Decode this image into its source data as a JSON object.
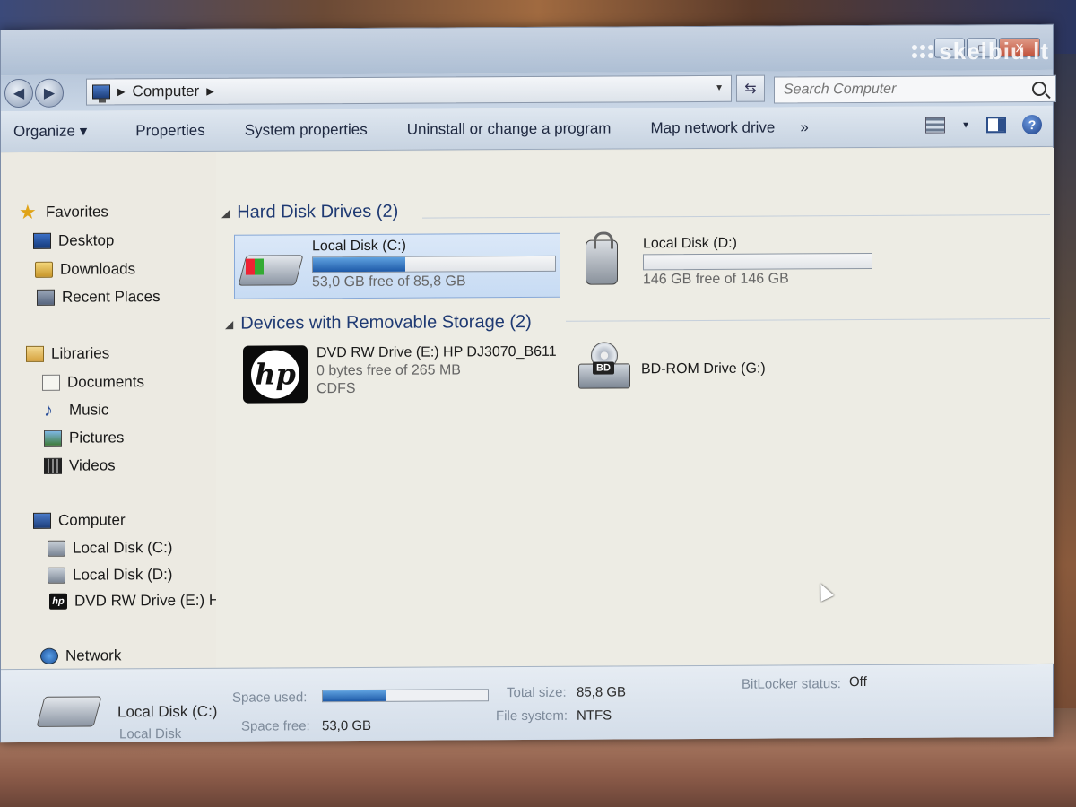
{
  "watermark": "skelbiu.lt",
  "window": {
    "controls": [
      "–",
      "□",
      "X"
    ]
  },
  "address": {
    "location": "Computer",
    "separator": "▸",
    "search_placeholder": "Search Computer"
  },
  "toolbar": {
    "items": [
      "Organize ▾",
      "Properties",
      "System properties",
      "Uninstall or change a program",
      "Map network drive",
      "»"
    ]
  },
  "nav": {
    "favorites": "Favorites",
    "desktop": "Desktop",
    "downloads": "Downloads",
    "recent": "Recent Places",
    "libraries": "Libraries",
    "documents": "Documents",
    "music": "Music",
    "pictures": "Pictures",
    "videos": "Videos",
    "computer": "Computer",
    "drive_c": "Local Disk (C:)",
    "drive_d": "Local Disk (D:)",
    "drive_e": "DVD RW Drive (E:) H",
    "network": "Network"
  },
  "groups": {
    "hard_disks": "Hard Disk Drives (2)",
    "removable": "Devices with Removable Storage (2)"
  },
  "drives": {
    "c": {
      "name": "Local Disk (C:)",
      "free_text": "53,0 GB free of 85,8 GB",
      "used_fraction": 0.38
    },
    "d": {
      "name": "Local Disk (D:)",
      "free_text": "146 GB free of 146 GB",
      "used_fraction": 0.0
    },
    "e": {
      "name": "DVD RW Drive (E:) HP DJ3070_B611",
      "free_text": "0 bytes free of 265 MB",
      "fs": "CDFS"
    },
    "g": {
      "name": "BD-ROM Drive (G:)"
    }
  },
  "details": {
    "name": "Local Disk (C:)",
    "type": "Local Disk",
    "space_used_label": "Space used:",
    "space_free_label": "Space free:",
    "space_free_value": "53,0 GB",
    "used_fraction": 0.38,
    "total_size_label": "Total size:",
    "total_size_value": "85,8 GB",
    "file_system_label": "File system:",
    "file_system_value": "NTFS",
    "bitlocker_label": "BitLocker status:",
    "bitlocker_value": "Off"
  },
  "colors": {
    "bar_fill": "#1e5aa8",
    "group_header": "#1f3a73",
    "selection": "#c7dbf3"
  }
}
